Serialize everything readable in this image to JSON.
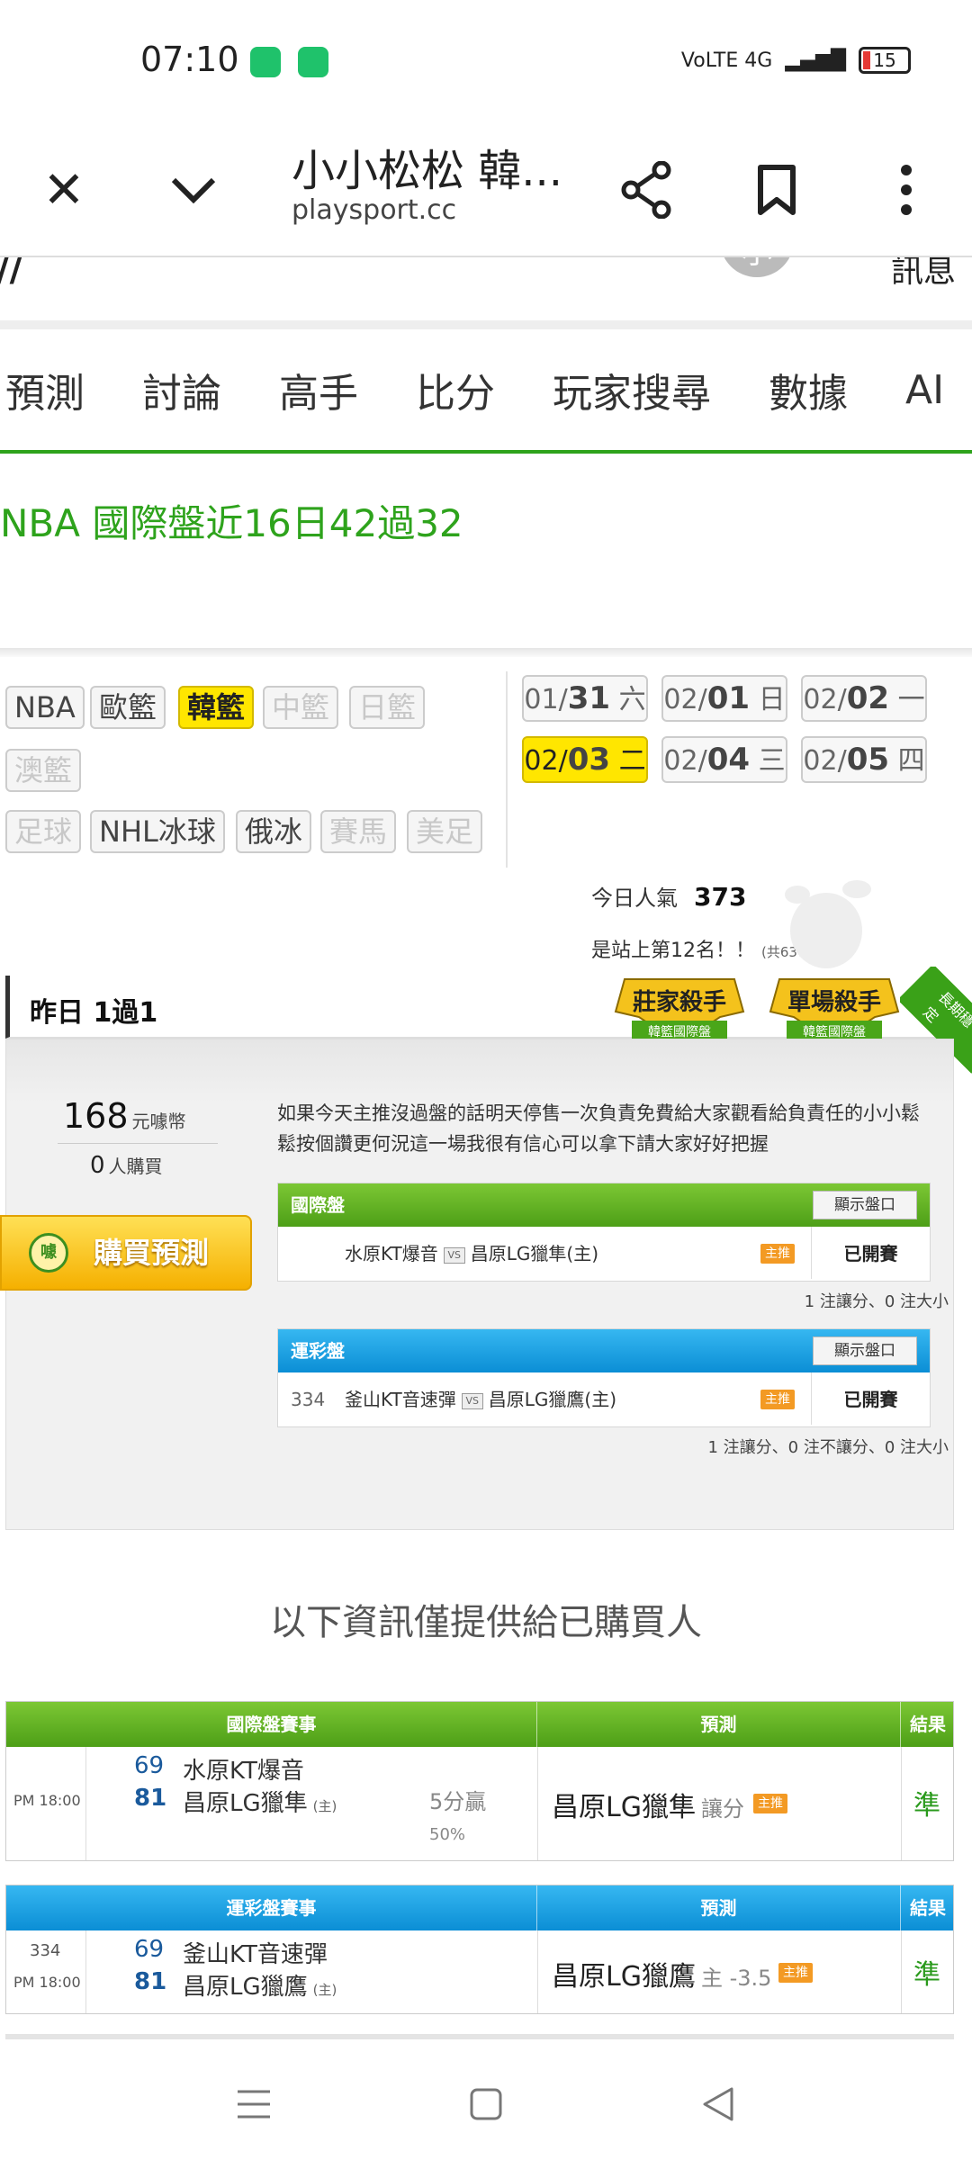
{
  "status_bar": {
    "time": "07:10",
    "network": "VoLTE 4G",
    "battery": "15"
  },
  "browser": {
    "title": "小小松松 韓...",
    "url": "playsport.cc"
  },
  "partial_header": {
    "mark": "//",
    "avatar_char": "小",
    "text": "訊息"
  },
  "nav_tabs": [
    "預測",
    "討論",
    "高手",
    "比分",
    "玩家搜尋",
    "數據",
    "AI"
  ],
  "headline": "NBA 國際盤近16日42過32",
  "categories": {
    "row1": [
      {
        "label": "NBA",
        "state": "normal"
      },
      {
        "label": "歐籃",
        "state": "normal"
      },
      {
        "label": "韓籃",
        "state": "active"
      },
      {
        "label": "中籃",
        "state": "disabled"
      },
      {
        "label": "日籃",
        "state": "disabled"
      }
    ],
    "row2": [
      {
        "label": "澳籃",
        "state": "disabled"
      }
    ],
    "row3": [
      {
        "label": "足球",
        "state": "disabled"
      },
      {
        "label": "NHL冰球",
        "state": "normal"
      },
      {
        "label": "俄冰",
        "state": "normal"
      },
      {
        "label": "賽馬",
        "state": "disabled"
      },
      {
        "label": "美足",
        "state": "disabled"
      }
    ]
  },
  "dates": [
    {
      "month": "01/",
      "day": "31",
      "weekday": "六",
      "active": false
    },
    {
      "month": "02/",
      "day": "01",
      "weekday": "日",
      "active": false
    },
    {
      "month": "02/",
      "day": "02",
      "weekday": "一",
      "active": false
    },
    {
      "month": "02/",
      "day": "03",
      "weekday": "二",
      "active": true
    },
    {
      "month": "02/",
      "day": "04",
      "weekday": "三",
      "active": false
    },
    {
      "month": "02/",
      "day": "05",
      "weekday": "四",
      "active": false
    }
  ],
  "popularity": {
    "label": "今日人氣",
    "value": "373",
    "rank_text": "是站上第12名！！",
    "rank_total": "(共6374人)"
  },
  "card": {
    "header": "昨日 1過1",
    "badge_a": {
      "title": "莊家殺手",
      "sub": "韓籃國際盤"
    },
    "badge_b": {
      "title": "單場殺手",
      "sub": "韓籃國際盤"
    },
    "ribbon": "長期穩定",
    "price": "168",
    "price_unit": "元噱幣",
    "buyers": "0",
    "buyers_unit": "人購買",
    "buy_button": "購買預測",
    "buy_coin": "噱",
    "description": "如果今天主推沒過盤的話明天停售一次負責免費給大家觀看給負責任的小小鬆鬆按個讚更何況這一場我很有信心可以拿下請大家好好把握",
    "intl": {
      "title": "國際盤",
      "show_btn": "顯示盤口",
      "num": "",
      "team_a": "水原KT爆音",
      "vs": "VS",
      "team_b": "昌原LG獵隼(主)",
      "tag": "主推",
      "status": "已開賽",
      "note": "1 注讓分、0 注大小"
    },
    "lottery": {
      "title": "運彩盤",
      "show_btn": "顯示盤口",
      "num": "334",
      "team_a": "釜山KT音速彈",
      "vs": "VS",
      "team_b": "昌原LG獵鷹(主)",
      "tag": "主推",
      "status": "已開賽",
      "note": "1 注讓分、0 注不讓分、0 注大小"
    }
  },
  "info_title": "以下資訊僅提供給已購買人",
  "table_intl": {
    "headers": [
      "國際盤賽事",
      "預測",
      "結果"
    ],
    "row": {
      "num": "",
      "time": "PM 18:00",
      "score_a": "69",
      "team_a": "水原KT爆音",
      "score_b": "81",
      "team_b": "昌原LG獵隼",
      "home": "(主)",
      "margin": "5分贏",
      "margin_pct": "50%",
      "prediction": "昌原LG獵隼",
      "prediction_type": "讓分",
      "tag": "主推",
      "result": "準"
    }
  },
  "table_lottery": {
    "headers": [
      "運彩盤賽事",
      "預測",
      "結果"
    ],
    "row": {
      "num": "334",
      "time": "PM 18:00",
      "score_a": "69",
      "team_a": "釜山KT音速彈",
      "score_b": "81",
      "team_b": "昌原LG獵鷹",
      "home": "(主)",
      "prediction": "昌原LG獵鷹",
      "prediction_type": "主 -3.5",
      "tag": "主推",
      "result": "準"
    }
  },
  "colors": {
    "brand_green": "#2ea31c",
    "highlight_yellow": "#ffe600",
    "header_blue": "#0b8ed5",
    "accent_orange": "#f39a24"
  }
}
